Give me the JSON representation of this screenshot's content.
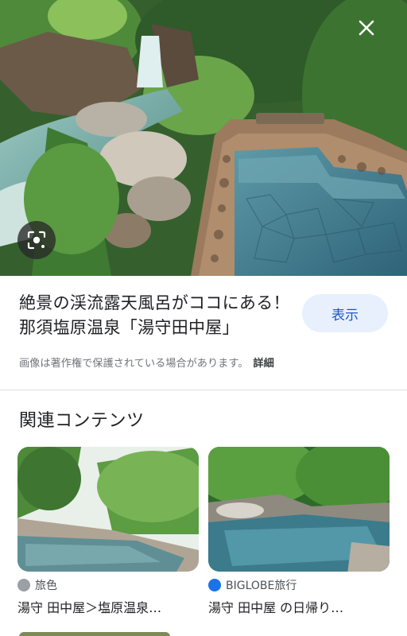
{
  "image": {
    "alt": "渓流露天風呂",
    "close_icon": "close-icon",
    "lens_icon": "lens-icon"
  },
  "result": {
    "title": "絶景の渓流露天風呂がココにある！那須塩原温泉「湯守田中屋」",
    "view_button": "表示",
    "copyright_text": "画像は著作権で保護されている場合があります。",
    "details_link": "詳細"
  },
  "related": {
    "heading": "関連コンテンツ",
    "cards": [
      {
        "source": "旅色",
        "title": "湯守 田中屋＞塩原温泉…",
        "source_icon": "tabiiro-logo-icon",
        "icon_color": "#9aa0a6"
      },
      {
        "source": "BIGLOBE旅行",
        "title": "湯守 田中屋 の日帰り…",
        "source_icon": "biglobe-logo-icon",
        "icon_color": "#1a73e8"
      }
    ]
  },
  "colors": {
    "accent": "#1a56c4",
    "button_bg": "#e8f0fe",
    "divider": "#dadce0"
  }
}
